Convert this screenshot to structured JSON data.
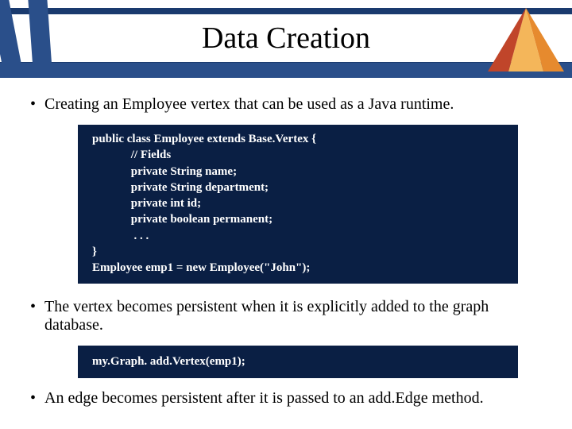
{
  "header": {
    "title": "Data Creation"
  },
  "bullets": {
    "b1": "Creating an Employee vertex that can be used as a Java runtime.",
    "b2": "The vertex becomes persistent when it is explicitly added to the graph database.",
    "b3": "An edge becomes persistent after it is passed to an add.Edge method."
  },
  "code": {
    "block1": "public class Employee extends Base.Vertex {\n             // Fields\n             private String name;\n             private String department;\n             private int id;\n             private boolean permanent;\n              . . .\n}\nEmployee emp1 = new Employee(\"John\");",
    "block2": "my.Graph. add.Vertex(emp1);"
  }
}
